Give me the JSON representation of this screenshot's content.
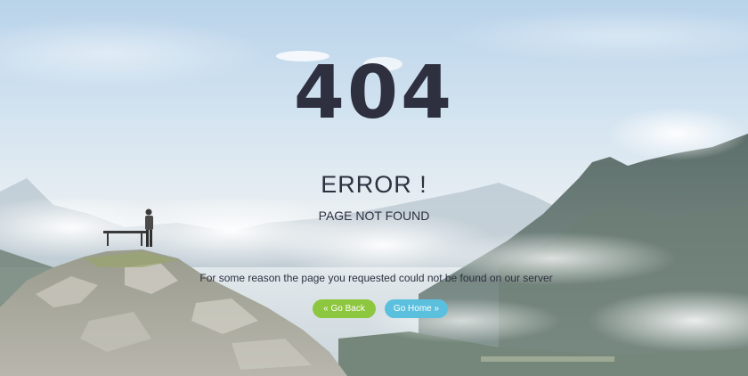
{
  "error": {
    "code": "404",
    "title": "ERROR !",
    "subtitle": "PAGE NOT FOUND",
    "message": "For some reason the page you requested could not be found on our server"
  },
  "buttons": {
    "back_label": "« Go Back",
    "home_label": "Go Home »"
  },
  "colors": {
    "text": "#2e3040",
    "back_button": "#8dc63f",
    "home_button": "#5bc0de"
  }
}
